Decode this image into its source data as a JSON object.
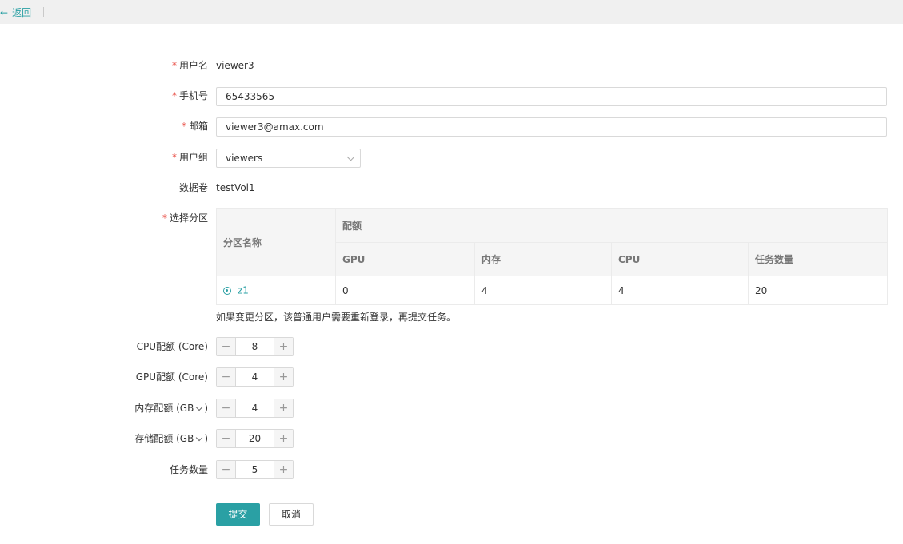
{
  "topbar": {
    "back_icon": "←",
    "back_label": "返回"
  },
  "form": {
    "username": {
      "label": "用户名",
      "required": "*",
      "value": "viewer3"
    },
    "phone": {
      "label": "手机号",
      "required": "*",
      "value": "65433565"
    },
    "email": {
      "label": "邮箱",
      "required": "*",
      "value": "viewer3@amax.com"
    },
    "group": {
      "label": "用户组",
      "required": "*",
      "value": "viewers"
    },
    "volume": {
      "label": "数据卷",
      "value": "testVol1"
    },
    "partition": {
      "label": "选择分区",
      "required": "*",
      "table": {
        "name_header": "分区名称",
        "quota_header": "配额",
        "columns": [
          "GPU",
          "内存",
          "CPU",
          "任务数量"
        ],
        "rows": [
          {
            "name": "z1",
            "selected": true,
            "values": [
              "0",
              "4",
              "4",
              "20"
            ]
          }
        ]
      },
      "hint": "如果变更分区，该普通用户需要重新登录，再提交任务。"
    },
    "cpu_quota": {
      "label": "CPU配额 (Core)",
      "value": "8"
    },
    "gpu_quota": {
      "label": "GPU配额 (Core)",
      "value": "4"
    },
    "mem_quota": {
      "label": "内存配额 (GB",
      "suffix": ")",
      "value": "4"
    },
    "storage_quota": {
      "label": "存储配额 (GB",
      "suffix": ")",
      "value": "20"
    },
    "task_count": {
      "label": "任务数量",
      "value": "5"
    },
    "stepper_minus": "−",
    "stepper_plus": "+"
  },
  "actions": {
    "submit_label": "提交",
    "cancel_label": "取消"
  },
  "colors": {
    "accent": "#2aa0a4",
    "required": "#e8483f"
  }
}
